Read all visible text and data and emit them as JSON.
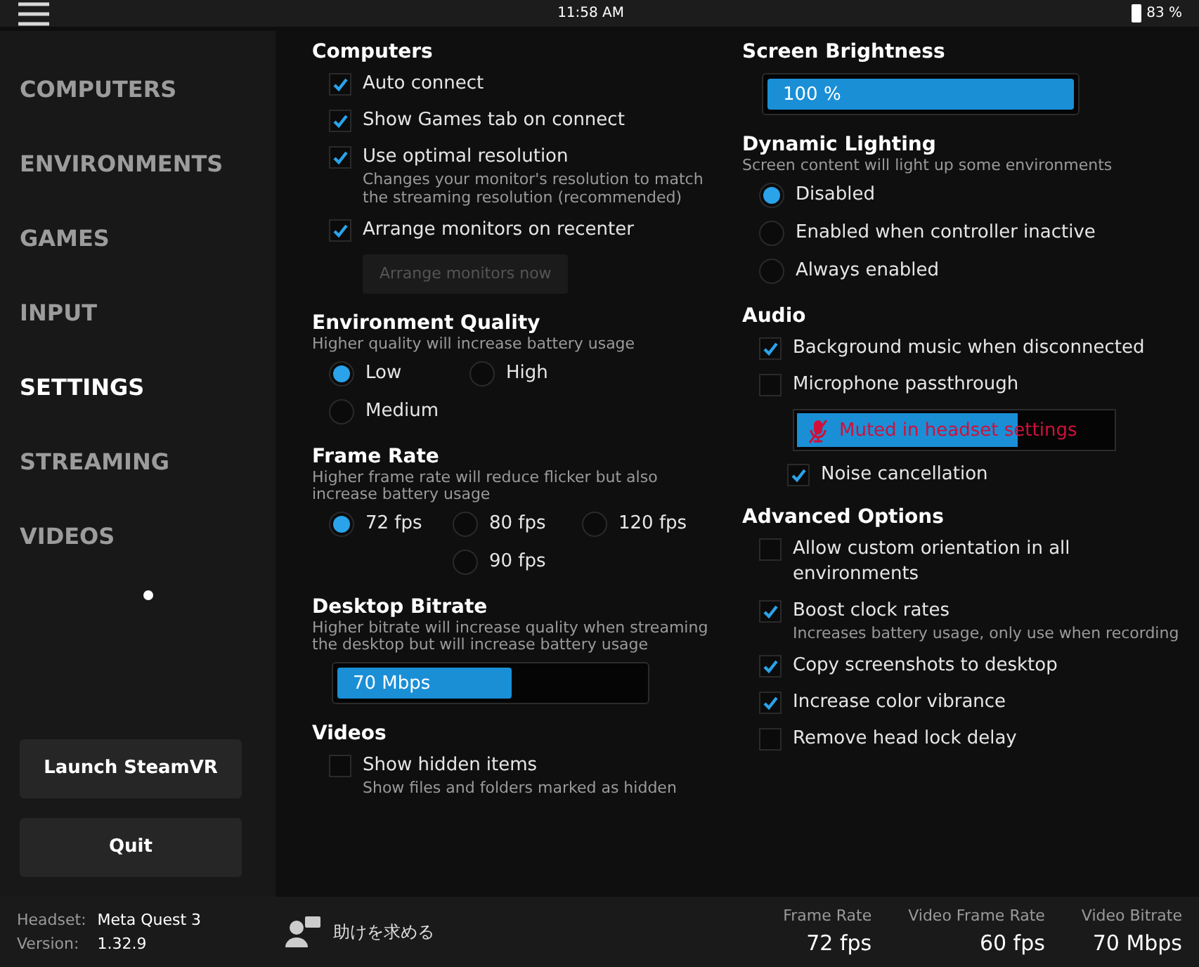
{
  "status_bar": {
    "time": "11:58 AM",
    "battery": "83 %"
  },
  "sidebar": {
    "items": [
      {
        "label": "COMPUTERS",
        "selected": false
      },
      {
        "label": "ENVIRONMENTS",
        "selected": false
      },
      {
        "label": "GAMES",
        "selected": false
      },
      {
        "label": "INPUT",
        "selected": false
      },
      {
        "label": "SETTINGS",
        "selected": true
      },
      {
        "label": "STREAMING",
        "selected": false
      },
      {
        "label": "VIDEOS",
        "selected": false
      }
    ],
    "buttons": [
      "Launch SteamVR",
      "Quit"
    ]
  },
  "left_column": [
    {
      "kind": "checks",
      "title": "Computers",
      "items": [
        {
          "label": "Auto connect",
          "checked": true
        },
        {
          "label": "Show Games tab on connect",
          "checked": true
        },
        {
          "label": "Use optimal resolution",
          "checked": true,
          "hint": "Changes your monitor's resolution to match the streaming resolution (recommended)"
        },
        {
          "label": "Arrange monitors on recenter",
          "checked": true
        }
      ],
      "button": {
        "label": "Arrange monitors now",
        "disabled": true
      }
    },
    {
      "kind": "radiopairs",
      "title": "Environment Quality",
      "hint": "Higher quality will increase battery usage",
      "options": [
        {
          "label": "Low",
          "selected": true
        },
        {
          "label": "High",
          "selected": false
        },
        {
          "label": "Medium",
          "selected": false
        }
      ]
    },
    {
      "kind": "radiotriples",
      "title": "Frame Rate",
      "hint": "Higher frame rate will reduce flicker but also increase battery usage",
      "options": [
        {
          "label": "72 fps",
          "selected": true
        },
        {
          "label": "80 fps",
          "selected": false
        },
        {
          "label": "120 fps",
          "selected": false
        },
        {
          "label": "90 fps",
          "selected": false
        }
      ]
    },
    {
      "kind": "slider",
      "title": "Desktop Bitrate",
      "hint": "Higher bitrate will increase quality when streaming the desktop but will increase battery usage",
      "value": "70 Mbps",
      "level": 0.57
    },
    {
      "kind": "checks",
      "title": "Videos",
      "items": [
        {
          "label": "Show hidden items",
          "checked": false,
          "hint": "Show files and folders marked as hidden"
        }
      ]
    }
  ],
  "right_column": [
    {
      "kind": "slider",
      "title": "Screen Brightness",
      "value": "100 %",
      "level": 1
    },
    {
      "kind": "radiolist",
      "title": "Dynamic Lighting",
      "hint": "Screen content will light up some environments",
      "options": [
        {
          "label": "Disabled",
          "selected": true
        },
        {
          "label": "Enabled when controller inactive",
          "selected": false
        },
        {
          "label": "Always enabled",
          "selected": false
        }
      ]
    },
    {
      "kind": "checks",
      "title": "Audio",
      "items": [
        {
          "label": "Background music when disconnected",
          "checked": true
        },
        {
          "label": "Microphone passthrough",
          "checked": false
        }
      ],
      "muted_bar": {
        "text": "Muted in headset settings",
        "level": 0.7
      },
      "sub_items": [
        {
          "label": "Noise cancellation",
          "checked": true
        }
      ]
    },
    {
      "kind": "checks",
      "title": "Advanced Options",
      "items": [
        {
          "label": "Allow custom orientation in all environments",
          "checked": false
        },
        {
          "label": "Boost clock rates",
          "checked": true,
          "hint": "Increases battery usage, only use when recording"
        },
        {
          "label": "Copy screenshots to desktop",
          "checked": true
        },
        {
          "label": "Increase color vibrance",
          "checked": true
        },
        {
          "label": "Remove head lock delay",
          "checked": false
        }
      ]
    }
  ],
  "footer": {
    "headset_label": "Headset:",
    "headset": "Meta Quest 3",
    "version_label": "Version:",
    "version": "1.32.9",
    "help": "助けを求める",
    "stats": [
      {
        "label": "Frame Rate",
        "value": "72 fps"
      },
      {
        "label": "Video Frame Rate",
        "value": "60 fps"
      },
      {
        "label": "Video Bitrate",
        "value": "70 Mbps"
      }
    ]
  }
}
